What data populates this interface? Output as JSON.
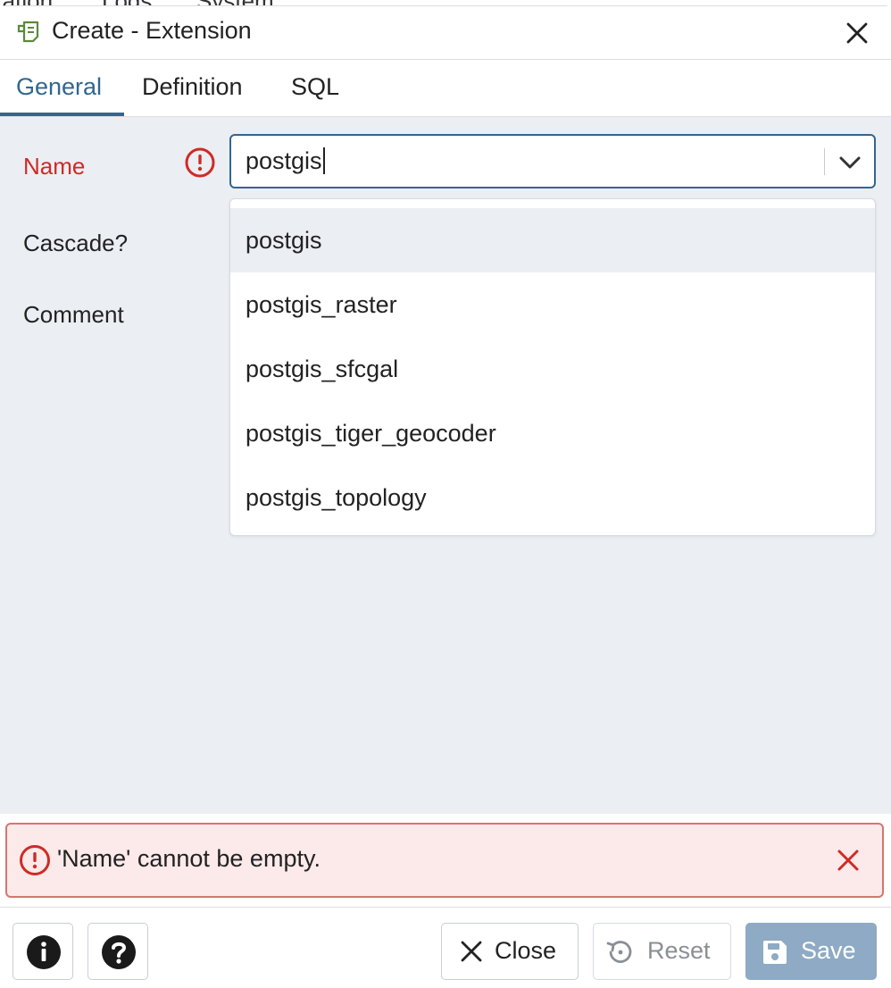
{
  "background_menu": [
    "ration",
    "Logs",
    "System"
  ],
  "dialog": {
    "title": "Create - Extension",
    "icon": "extension-icon",
    "close_icon": "close-icon"
  },
  "tabs": [
    {
      "label": "General",
      "active": true
    },
    {
      "label": "Definition",
      "active": false
    },
    {
      "label": "SQL",
      "active": false
    }
  ],
  "form": {
    "name_label": "Name",
    "name_value": "postgis",
    "cascade_label": "Cascade?",
    "comment_label": "Comment"
  },
  "dropdown": {
    "options": [
      "postgis",
      "postgis_raster",
      "postgis_sfcgal",
      "postgis_tiger_geocoder",
      "postgis_topology"
    ],
    "highlighted_index": 0
  },
  "error": {
    "message": "'Name' cannot be empty."
  },
  "footer": {
    "info_icon": "info-icon",
    "help_icon": "help-icon",
    "close_label": "Close",
    "reset_label": "Reset",
    "save_label": "Save"
  },
  "colors": {
    "accent": "#326690",
    "error": "#ce2b26",
    "content_bg": "#ebeef3",
    "save_disabled": "#8eaac4"
  }
}
